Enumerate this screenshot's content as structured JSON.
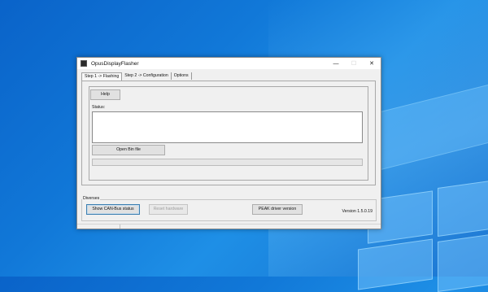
{
  "window": {
    "title": "OpusDisplayFlasher",
    "minimize_glyph": "—",
    "maximize_glyph": "☐",
    "close_glyph": "✕"
  },
  "tabs": [
    {
      "label": "Step 1 -> Flashing",
      "active": true
    },
    {
      "label": "Step 2 -> Configuration",
      "active": false
    },
    {
      "label": "Options",
      "active": false
    }
  ],
  "flashing": {
    "help_label": "Help",
    "status_label": "Status:",
    "status_text": "",
    "open_bin_label": "Open Bin file",
    "progress_percent": 0
  },
  "diverses": {
    "group_label": "Diverses",
    "can_status_label": "Show CAN-Bus status",
    "reset_label": "Reset hardware",
    "peak_label": "PEAK driver version",
    "version_text": "Version 1.5.0.19"
  },
  "icons": {
    "app": "app-window-icon"
  },
  "colors": {
    "desktop": "#1178d8",
    "window_bg": "#f0f0f0",
    "progress_fill": "#06b025"
  }
}
